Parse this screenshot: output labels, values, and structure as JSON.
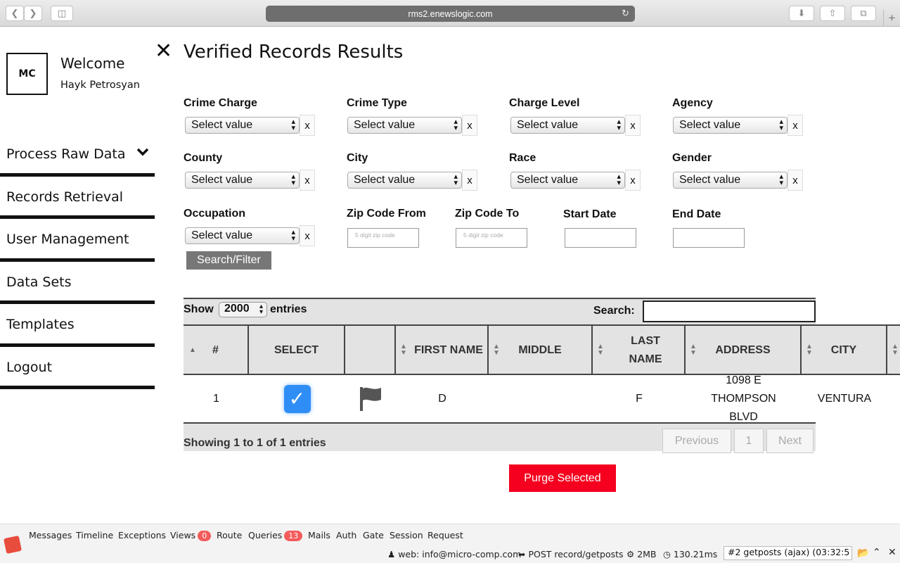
{
  "browser": {
    "url": "rms2.enewslogic.com"
  },
  "sidebar": {
    "logo": "MC",
    "welcome": "Welcome",
    "user": "Hayk Petrosyan",
    "items": [
      {
        "label": "Process Raw Data"
      },
      {
        "label": "Records Retrieval"
      },
      {
        "label": "User Management"
      },
      {
        "label": "Data Sets"
      },
      {
        "label": "Templates"
      },
      {
        "label": "Logout"
      }
    ]
  },
  "page": {
    "title": "Verified Records Results"
  },
  "filters": {
    "select_placeholder": "Select value",
    "clear": "x",
    "crime_charge": "Crime Charge",
    "crime_type": "Crime Type",
    "charge_level": "Charge Level",
    "agency": "Agency",
    "county": "County",
    "city": "City",
    "race": "Race",
    "gender": "Gender",
    "occupation": "Occupation",
    "zip_from": "Zip Code From",
    "zip_to": "Zip Code To",
    "zip_placeholder": "5 digit zip code",
    "start_date": "Start Date",
    "end_date": "End Date",
    "search_button": "Search/Filter"
  },
  "table": {
    "show": "Show",
    "length": "2000",
    "entries": "entries",
    "search": "Search:",
    "columns": [
      "#",
      "SELECT",
      "",
      "FIRST NAME",
      "MIDDLE",
      "LAST NAME",
      "ADDRESS",
      "CITY"
    ],
    "rows": [
      {
        "num": "1",
        "selected": true,
        "first": "D",
        "middle": "",
        "last": "F",
        "address": "1098 E THOMPSON BLVD",
        "city": "VENTURA"
      }
    ],
    "info": "Showing 1 to 1 of 1 entries",
    "previous": "Previous",
    "page": "1",
    "next": "Next"
  },
  "actions": {
    "purge": "Purge Selected"
  },
  "debugbar": {
    "tabs": [
      "Messages",
      "Timeline",
      "Exceptions",
      "Views",
      "Route",
      "Queries",
      "Mails",
      "Auth",
      "Gate",
      "Session",
      "Request"
    ],
    "views_count": "0",
    "queries_count": "13",
    "user": "web: info@micro-comp.com",
    "route": "POST record/getposts",
    "memory": "2MB",
    "time": "130.21ms",
    "request": "#2 getposts (ajax) (03:32:5"
  },
  "colors": {
    "accent_red": "#f5001f",
    "checkbox_blue": "#2f8ef5"
  }
}
